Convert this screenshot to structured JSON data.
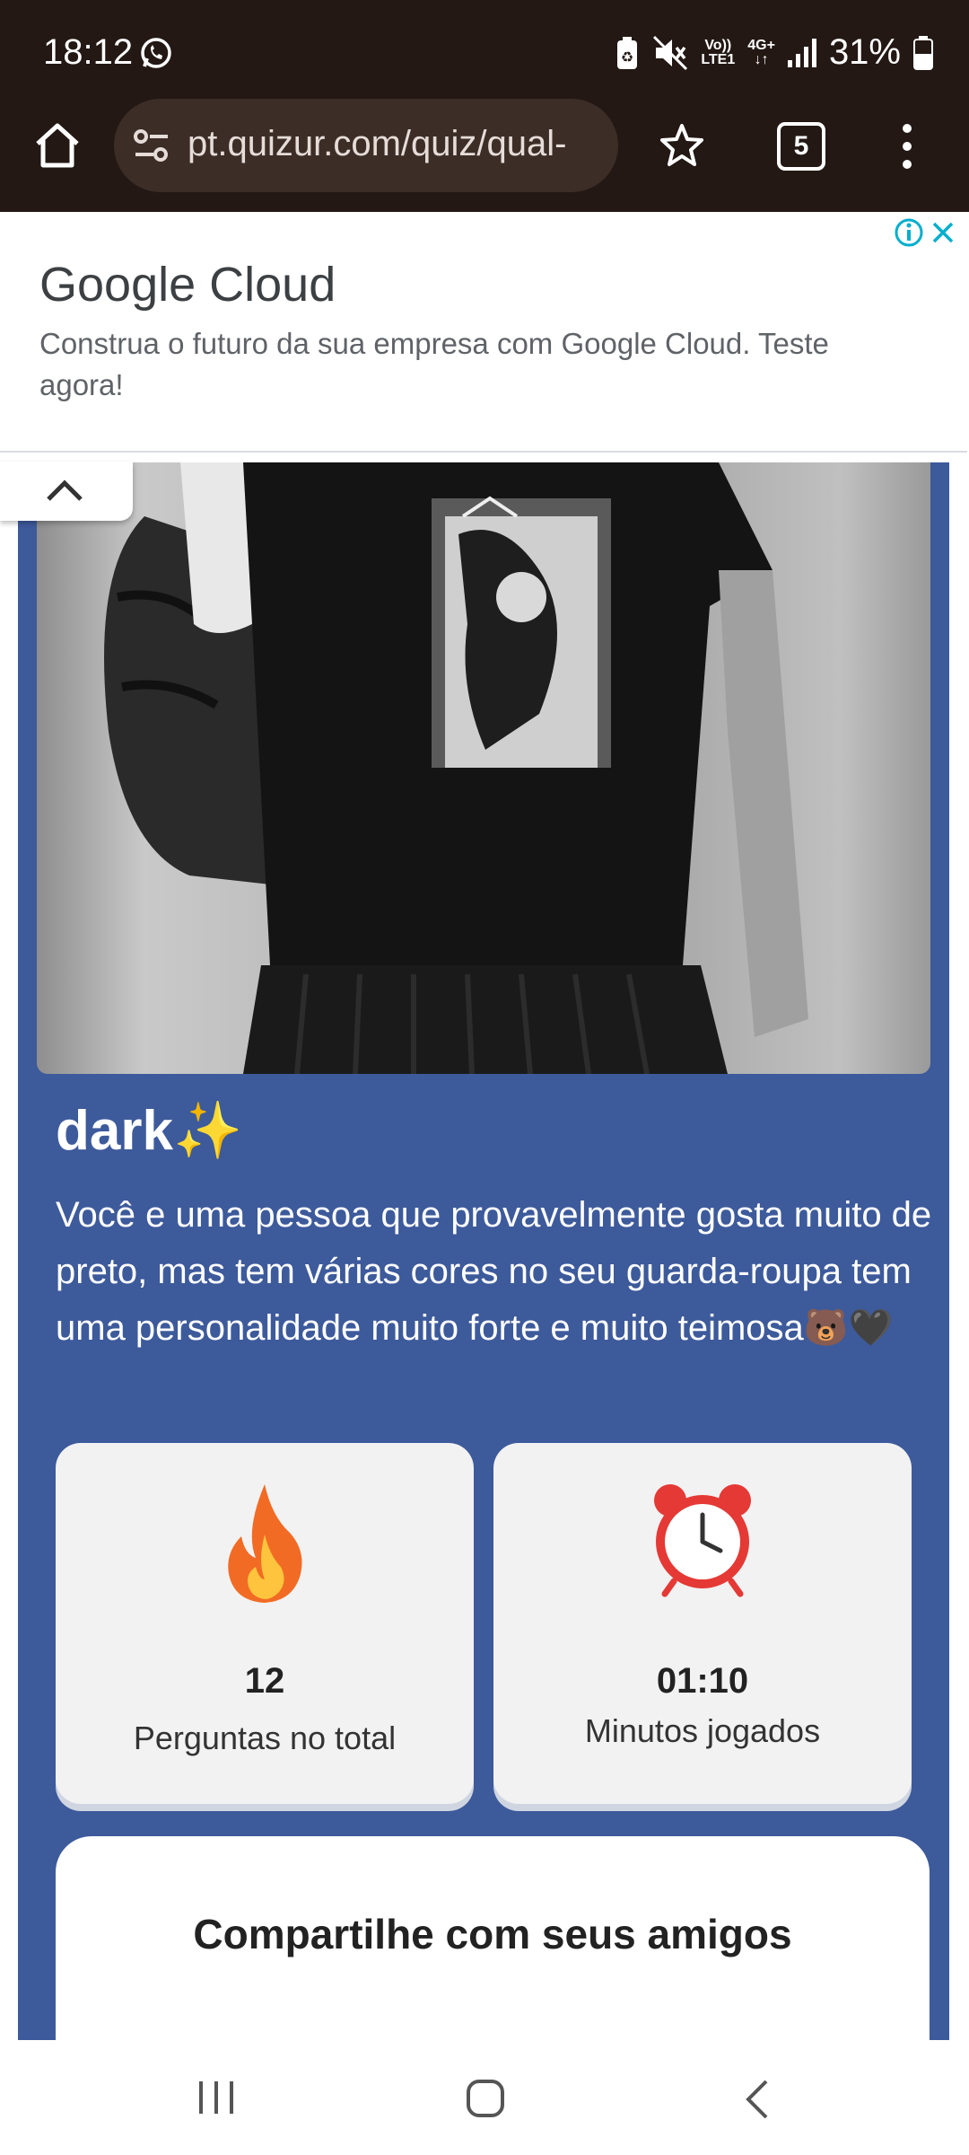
{
  "status_bar": {
    "time": "18:12",
    "network_top": "Vo))",
    "network_bottom": "LTE1",
    "network_type": "4G+",
    "battery": "31%"
  },
  "browser": {
    "url": "pt.quizur.com/quiz/qual-",
    "tab_count": "5"
  },
  "ad": {
    "title": "Google Cloud",
    "description": "Construa o futuro da sua empresa com Google Cloud. Teste agora!"
  },
  "result": {
    "title": "dark✨",
    "description": "Você e uma pessoa que provavelmente gosta muito de preto, mas tem várias cores no seu guarda-roupa tem uma personalidade muito forte e muito teimosa🐻🖤"
  },
  "stats": [
    {
      "icon": "fire-icon",
      "value": "12",
      "label": "Perguntas no total"
    },
    {
      "icon": "alarm-clock-icon",
      "value": "01:10",
      "label": "Minutos jogados"
    }
  ],
  "share": {
    "title": "Compartilhe com seus amigos"
  },
  "colors": {
    "card_bg": "#3d5a9b",
    "status_bg": "#231814",
    "omnibox_bg": "#3c2d27"
  }
}
